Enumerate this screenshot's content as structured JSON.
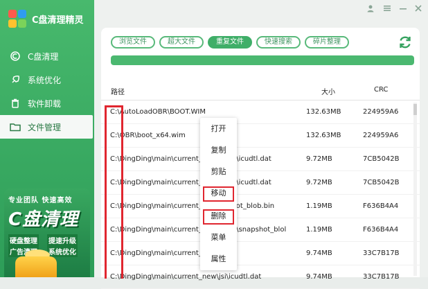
{
  "app": {
    "title": "C盘清理精灵"
  },
  "sidebar": {
    "items": [
      {
        "label": "C盘清理",
        "icon": "c-drive-icon"
      },
      {
        "label": "系统优化",
        "icon": "rocket-icon"
      },
      {
        "label": "软件卸载",
        "icon": "trash-icon"
      },
      {
        "label": "文件管理",
        "icon": "folder-icon"
      }
    ],
    "active_index": 3,
    "promo": {
      "line1": "专业团队 快速高效",
      "big": "C盘清理",
      "tags": [
        "硬盘整理",
        "提速升级",
        "广告清理",
        "系统优化"
      ]
    }
  },
  "tabs": [
    {
      "label": "浏览文件"
    },
    {
      "label": "超大文件"
    },
    {
      "label": "重复文件"
    },
    {
      "label": "快速搜索"
    },
    {
      "label": "碎片整理"
    }
  ],
  "active_tab": 2,
  "progress": {
    "percent": 100
  },
  "table": {
    "columns": [
      "路径",
      "大小",
      "CRC"
    ],
    "rows": [
      {
        "path": "C:\\AutoLoadOBR\\BOOT.WIM",
        "size": "132.63MB",
        "crc": "224959A6"
      },
      {
        "path": "C:\\OBR\\boot_x64.wim",
        "size": "132.63MB",
        "crc": "224959A6"
      },
      {
        "path": "C:\\DingDing\\main\\current_…runtime\\icudtl.dat",
        "size": "9.72MB",
        "crc": "7CB5042B"
      },
      {
        "path": "C:\\DingDing\\main\\current_…runtime\\icudtl.dat",
        "size": "9.72MB",
        "crc": "7CB5042B"
      },
      {
        "path": "C:\\DingDing\\main\\current_…\\snapshot_blob.bin",
        "size": "1.19MB",
        "crc": "F636B4A4"
      },
      {
        "path": "C:\\DingDing\\main\\current_…runtime\\snapshot_blol",
        "size": "1.19MB",
        "crc": "F636B4A4"
      },
      {
        "path": "C:\\DingDing\\main\\current_…t",
        "size": "9.74MB",
        "crc": "33C7B17B"
      },
      {
        "path": "C:\\DingDing\\main\\current_new\\jsi\\icudtl.dat",
        "size": "9.74MB",
        "crc": "33C7B17B"
      }
    ]
  },
  "context_menu": {
    "items": [
      "打开",
      "复制",
      "剪贴",
      "移动",
      "删除",
      "菜单",
      "属性"
    ],
    "highlighted": [
      "移动",
      "删除"
    ]
  },
  "colors": {
    "sidebar": "#3aab63",
    "accent": "#3fae68",
    "highlight": "#e0262f"
  }
}
